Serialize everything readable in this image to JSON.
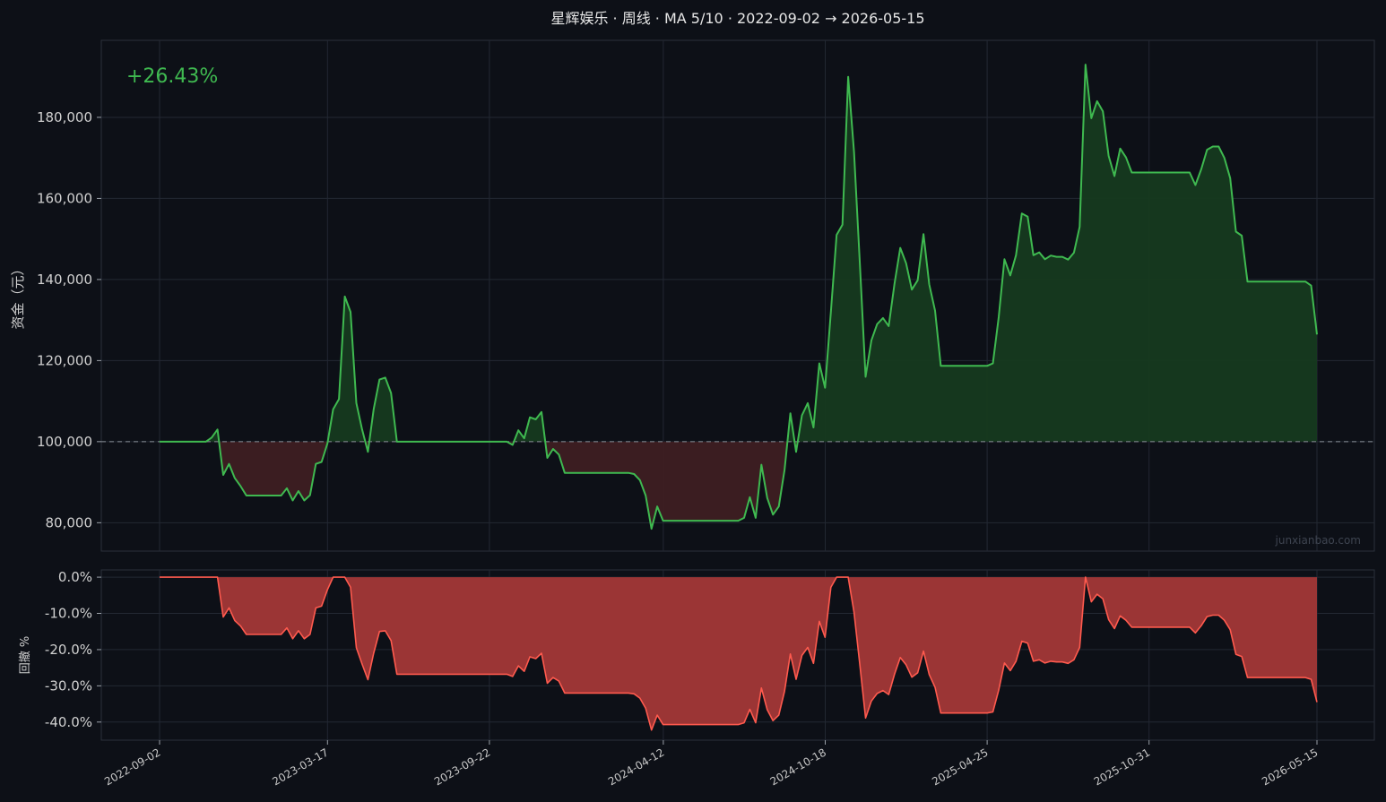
{
  "chart_data": [
    {
      "type": "area",
      "title": "星辉娱乐 · 周线 · MA 5/10 · 2022-09-02 → 2026-05-15",
      "ylabel": "资金（元）",
      "return_label": "+26.43%",
      "watermark": "junxianbao.com",
      "baseline": 100000,
      "ylim": [
        73000,
        199000
      ],
      "yticks": [
        80000,
        100000,
        120000,
        140000,
        160000,
        180000
      ],
      "ytick_labels": [
        "80,000",
        "100,000",
        "120,000",
        "140,000",
        "160,000",
        "180,000"
      ],
      "grid": true,
      "colors": {
        "line": "#3fb950",
        "gain_fill": "#163a1f",
        "loss_fill": "#3e1f22",
        "baseline": "#888888"
      },
      "series": [
        {
          "values": [
            100000,
            100000,
            100000,
            100000,
            100000,
            100000,
            100000,
            100000,
            100000,
            101000,
            103000,
            91800,
            94500,
            91000,
            89000,
            86700,
            86700,
            86700,
            86700,
            86700,
            86700,
            86700,
            88500,
            85500,
            87800,
            85500,
            86800,
            94500,
            95000,
            99500,
            108000,
            110500,
            135800,
            132000,
            109500,
            103000,
            97500,
            108000,
            115300,
            115800,
            112000,
            100000,
            100000,
            100000,
            100000,
            100000,
            100000,
            100000,
            100000,
            100000,
            100000,
            100000,
            100000,
            100000,
            100000,
            100000,
            100000,
            100000,
            100000,
            100000,
            100000,
            99200,
            102800,
            100800,
            106000,
            105500,
            107300,
            96000,
            98200,
            96800,
            92300,
            92300,
            92300,
            92300,
            92300,
            92300,
            92300,
            92300,
            92300,
            92300,
            92300,
            92300,
            92000,
            90500,
            86700,
            78500,
            84000,
            80500,
            80500,
            80500,
            80500,
            80500,
            80500,
            80500,
            80500,
            80500,
            80500,
            80500,
            80500,
            80500,
            80500,
            81200,
            86300,
            81200,
            94300,
            86100,
            82000,
            84000,
            93000,
            107000,
            97500,
            106500,
            109500,
            103500,
            119300,
            113300,
            132000,
            151000,
            153500,
            190000,
            171500,
            144000,
            116000,
            125000,
            129000,
            130500,
            128500,
            139000,
            147800,
            144000,
            137500,
            139800,
            151200,
            138800,
            132300,
            118700,
            118700,
            118700,
            118700,
            118700,
            118700,
            118700,
            118700,
            118700,
            119300,
            130700,
            145000,
            141000,
            146000,
            156300,
            155500,
            146000,
            146700,
            145000,
            145900,
            145600,
            145600,
            144900,
            146600,
            153000,
            193000,
            179800,
            184000,
            181500,
            170500,
            165500,
            172300,
            170100,
            166400,
            166400,
            166400,
            166400,
            166400,
            166400,
            166400,
            166400,
            166400,
            166400,
            166400,
            163300,
            167200,
            172000,
            172800,
            172800,
            170000,
            165000,
            151800,
            150800,
            139500,
            139500,
            139500,
            139500,
            139500,
            139500,
            139500,
            139500,
            139500,
            139500,
            139500,
            138500,
            126430
          ]
        }
      ],
      "x": {
        "start": "2022-09-02",
        "end": "2026-05-15",
        "tick_labels": [
          "2022-09-02",
          "2023-03-17",
          "2023-09-22",
          "2024-04-12",
          "2024-10-18",
          "2025-04-25",
          "2025-10-31",
          "2026-05-15"
        ]
      }
    },
    {
      "type": "area",
      "ylabel": "回撤 %",
      "ylim": [
        -45,
        2
      ],
      "yticks": [
        0,
        -10,
        -20,
        -30,
        -40
      ],
      "ytick_labels": [
        "0.0%",
        "-10.0%",
        "-20.0%",
        "-30.0%",
        "-40.0%"
      ],
      "grid": true,
      "colors": {
        "line": "#ff5a4e",
        "fill": "#9b3535"
      },
      "series": [
        {
          "values": [
            0,
            0,
            0,
            0,
            0,
            0,
            0,
            0,
            0,
            0,
            0,
            -11,
            -8.5,
            -12,
            -13.5,
            -15.8,
            -15.8,
            -15.8,
            -15.8,
            -15.8,
            -15.8,
            -15.8,
            -14,
            -17,
            -14.8,
            -17,
            -15.8,
            -8.5,
            -8,
            -3.5,
            0,
            0,
            0,
            -2.8,
            -19.5,
            -24,
            -28.3,
            -21,
            -15,
            -14.8,
            -17.5,
            -26.8,
            -26.8,
            -26.8,
            -26.8,
            -26.8,
            -26.8,
            -26.8,
            -26.8,
            -26.8,
            -26.8,
            -26.8,
            -26.8,
            -26.8,
            -26.8,
            -26.8,
            -26.8,
            -26.8,
            -26.8,
            -26.8,
            -26.8,
            -27.4,
            -24.5,
            -26,
            -22,
            -22.5,
            -21,
            -29.3,
            -27.7,
            -28.7,
            -32,
            -32,
            -32,
            -32,
            -32,
            -32,
            -32,
            -32,
            -32,
            -32,
            -32,
            -32,
            -32.2,
            -33.4,
            -36.2,
            -42.2,
            -38.1,
            -40.7,
            -40.7,
            -40.7,
            -40.7,
            -40.7,
            -40.7,
            -40.7,
            -40.7,
            -40.7,
            -40.7,
            -40.7,
            -40.7,
            -40.7,
            -40.7,
            -40.2,
            -36.5,
            -40.2,
            -30.6,
            -36.6,
            -39.6,
            -38.1,
            -31.5,
            -21.2,
            -28.2,
            -21.6,
            -19.4,
            -23.8,
            -12.2,
            -16.6,
            -2.8,
            0,
            0,
            0,
            -9.7,
            -24.2,
            -38.9,
            -34.2,
            -32.1,
            -31.3,
            -32.4,
            -26.8,
            -22.2,
            -24.2,
            -27.6,
            -26.4,
            -20.4,
            -26.9,
            -30.4,
            -37.5,
            -37.5,
            -37.5,
            -37.5,
            -37.5,
            -37.5,
            -37.5,
            -37.5,
            -37.5,
            -37.2,
            -31.2,
            -23.7,
            -25.8,
            -23.2,
            -17.7,
            -18.2,
            -23.2,
            -22.8,
            -23.7,
            -23.2,
            -23.4,
            -23.4,
            -23.8,
            -22.8,
            -19.4,
            0,
            -6.8,
            -4.7,
            -6,
            -11.7,
            -14.2,
            -10.7,
            -11.9,
            -13.8,
            -13.8,
            -13.8,
            -13.8,
            -13.8,
            -13.8,
            -13.8,
            -13.8,
            -13.8,
            -13.8,
            -13.8,
            -15.4,
            -13.4,
            -10.9,
            -10.5,
            -10.5,
            -11.9,
            -14.5,
            -21.3,
            -21.9,
            -27.7,
            -27.7,
            -27.7,
            -27.7,
            -27.7,
            -27.7,
            -27.7,
            -27.7,
            -27.7,
            -27.7,
            -27.7,
            -28.2,
            -34.5
          ]
        }
      ]
    }
  ]
}
